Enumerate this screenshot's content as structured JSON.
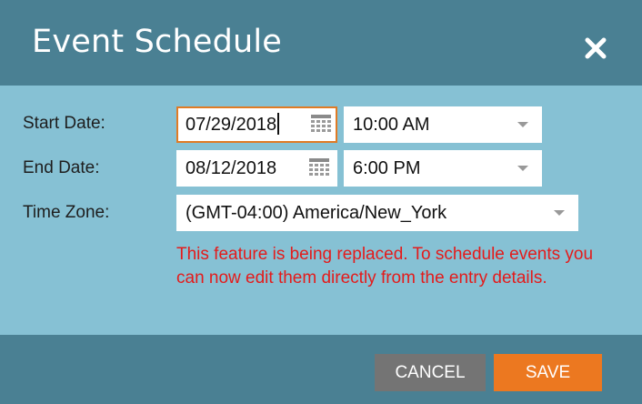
{
  "dialog": {
    "title": "Event Schedule",
    "close_icon": "close-icon"
  },
  "form": {
    "start_date": {
      "label": "Start Date:",
      "date_value": "07/29/2018",
      "time_value": "10:00 AM",
      "date_focused": true
    },
    "end_date": {
      "label": "End Date:",
      "date_value": "08/12/2018",
      "time_value": "6:00 PM"
    },
    "time_zone": {
      "label": "Time Zone:",
      "value": "(GMT-04:00) America/New_York"
    },
    "notice": "This feature is being replaced. To schedule events you can now edit them directly from the entry details."
  },
  "buttons": {
    "cancel_label": "CANCEL",
    "save_label": "SAVE"
  },
  "colors": {
    "header_bg": "#4a8093",
    "body_bg": "#86c1d4",
    "notice_text": "#e41b1b",
    "save_button": "#ec7820",
    "cancel_button": "#747474",
    "focus_border": "#e07b25"
  }
}
